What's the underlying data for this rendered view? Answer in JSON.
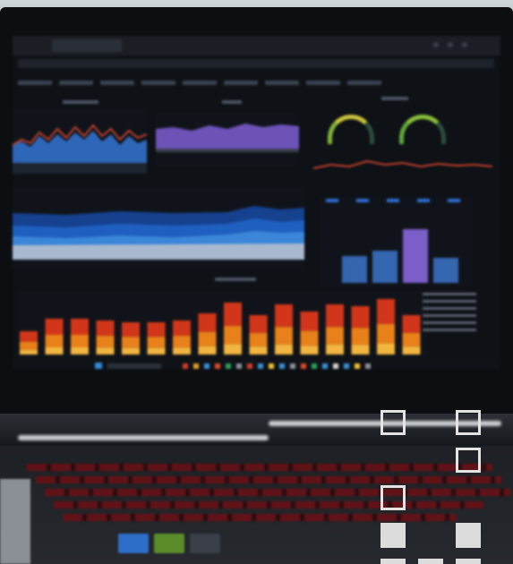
{
  "scene": "photo-of-laptop-displaying-dashboard",
  "colors": {
    "screen_bg": "#0e1116",
    "accent_orange": "#e8811a",
    "accent_red": "#d23a16",
    "accent_blue": "#3c7fd6",
    "accent_purple": "#7e5bc9",
    "keyboard_backlight": "#b0141c"
  },
  "overlay_marks": [
    {
      "id": "r1c1",
      "filled": false
    },
    {
      "id": "r1c3",
      "filled": false
    },
    {
      "id": "r2c3",
      "filled": false
    },
    {
      "id": "r3c1",
      "filled": false
    },
    {
      "id": "r4c1",
      "filled": true
    },
    {
      "id": "r4c3",
      "filled": true
    }
  ]
}
